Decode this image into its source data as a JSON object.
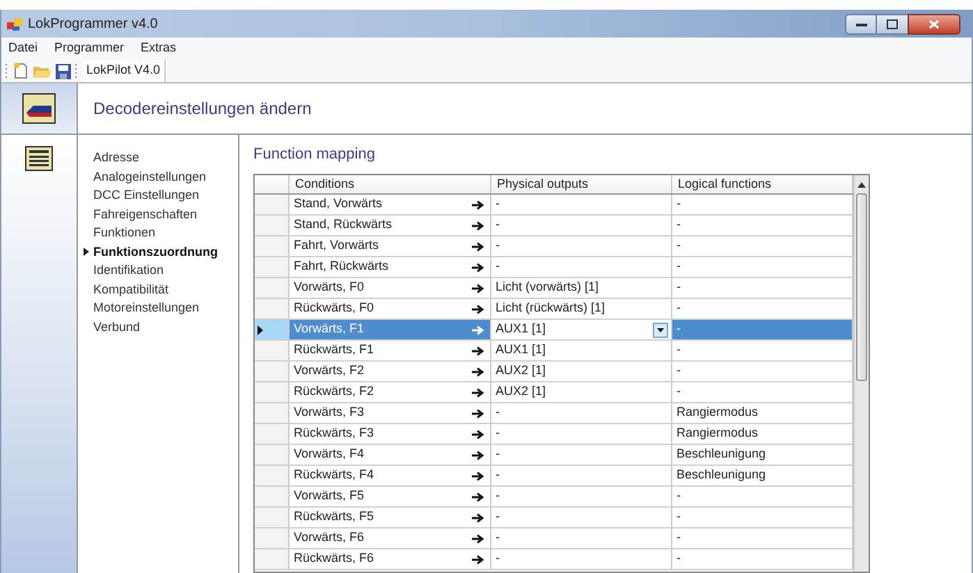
{
  "window": {
    "title": "LokProgrammer v4.0"
  },
  "menu": [
    "Datei",
    "Programmer",
    "Extras"
  ],
  "toolbar": {
    "document_tab": "LokPilot V4.0"
  },
  "header": {
    "title": "Decodereinstellungen ändern"
  },
  "nav": [
    {
      "label": "Adresse",
      "selected": false
    },
    {
      "label": "Analogeinstellungen",
      "selected": false
    },
    {
      "label": "DCC Einstellungen",
      "selected": false
    },
    {
      "label": "Fahreigenschaften",
      "selected": false
    },
    {
      "label": "Funktionen",
      "selected": false
    },
    {
      "label": "Funktionszuordnung",
      "selected": true
    },
    {
      "label": "Identifikation",
      "selected": false
    },
    {
      "label": "Kompatibilität",
      "selected": false
    },
    {
      "label": "Motoreinstellungen",
      "selected": false
    },
    {
      "label": "Verbund",
      "selected": false
    }
  ],
  "panel": {
    "title": "Function mapping"
  },
  "table": {
    "columns": [
      "Conditions",
      "Physical outputs",
      "Logical functions"
    ],
    "rows": [
      {
        "condition": "Stand, Vorwärts",
        "output": "-",
        "logic": "-",
        "selected": false
      },
      {
        "condition": "Stand, Rückwärts",
        "output": "-",
        "logic": "-",
        "selected": false
      },
      {
        "condition": "Fahrt, Vorwärts",
        "output": "-",
        "logic": "-",
        "selected": false
      },
      {
        "condition": "Fahrt, Rückwärts",
        "output": "-",
        "logic": "-",
        "selected": false
      },
      {
        "condition": "Vorwärts, F0",
        "output": "Licht (vorwärts) [1]",
        "logic": "-",
        "selected": false
      },
      {
        "condition": "Rückwärts, F0",
        "output": "Licht (rückwärts) [1]",
        "logic": "-",
        "selected": false
      },
      {
        "condition": "Vorwärts, F1",
        "output": "AUX1 [1]",
        "logic": "-",
        "selected": true
      },
      {
        "condition": "Rückwärts, F1",
        "output": "AUX1 [1]",
        "logic": "-",
        "selected": false
      },
      {
        "condition": "Vorwärts, F2",
        "output": "AUX2 [1]",
        "logic": "-",
        "selected": false
      },
      {
        "condition": "Rückwärts, F2",
        "output": "AUX2 [1]",
        "logic": "-",
        "selected": false
      },
      {
        "condition": "Vorwärts, F3",
        "output": "-",
        "logic": "Rangiermodus",
        "selected": false
      },
      {
        "condition": "Rückwärts, F3",
        "output": "-",
        "logic": "Rangiermodus",
        "selected": false
      },
      {
        "condition": "Vorwärts, F4",
        "output": "-",
        "logic": "Beschleunigung",
        "selected": false
      },
      {
        "condition": "Rückwärts, F4",
        "output": "-",
        "logic": "Beschleunigung",
        "selected": false
      },
      {
        "condition": "Vorwärts, F5",
        "output": "-",
        "logic": "-",
        "selected": false
      },
      {
        "condition": "Rückwärts, F5",
        "output": "-",
        "logic": "-",
        "selected": false
      },
      {
        "condition": "Vorwärts, F6",
        "output": "-",
        "logic": "-",
        "selected": false
      },
      {
        "condition": "Rückwärts, F6",
        "output": "-",
        "logic": "-",
        "selected": false
      }
    ]
  }
}
